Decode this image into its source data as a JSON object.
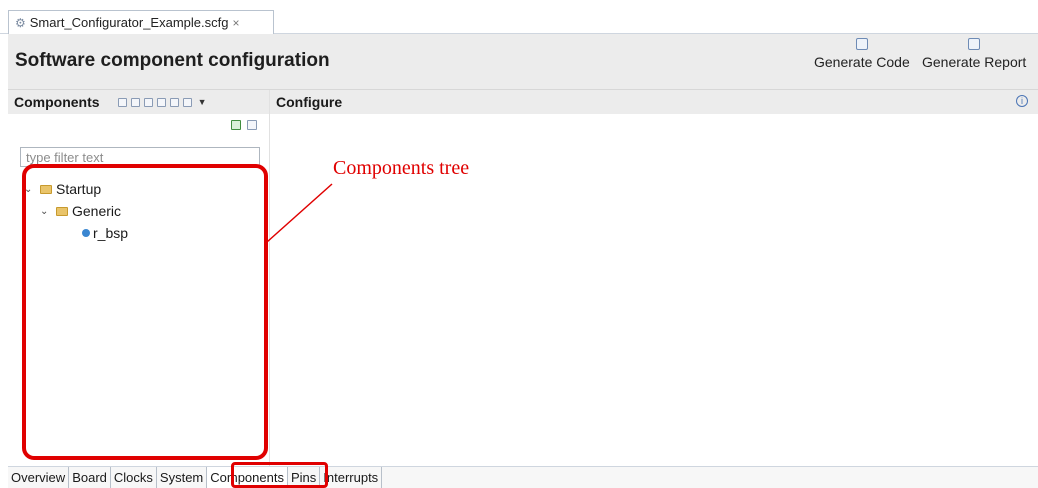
{
  "editor": {
    "tab_label": "Smart_Configurator_Example.scfg",
    "tab_close": "×"
  },
  "header": {
    "title": "Software component configuration",
    "actions": [
      {
        "label": "Generate Code",
        "icon": "generate-code-icon"
      },
      {
        "label": "Generate Report",
        "icon": "generate-report-icon"
      }
    ]
  },
  "components_panel": {
    "title": "Components",
    "filter_placeholder": "type filter text",
    "tree": [
      {
        "label": "Startup",
        "level": 1,
        "expanded": true,
        "type": "folder"
      },
      {
        "label": "Generic",
        "level": 2,
        "expanded": true,
        "type": "folder"
      },
      {
        "label": "r_bsp",
        "level": 3,
        "type": "component"
      }
    ]
  },
  "configure_panel": {
    "title": "Configure"
  },
  "bottom_tabs": [
    "Overview",
    "Board",
    "Clocks",
    "System",
    "Components",
    "Pins",
    "Interrupts"
  ],
  "active_bottom_tab": "Components",
  "annotation": {
    "label": "Components tree",
    "color": "#e00000"
  }
}
